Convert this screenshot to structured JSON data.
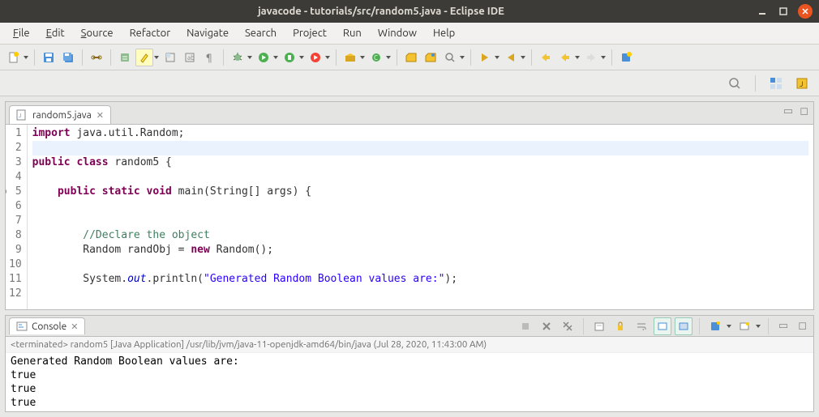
{
  "window": {
    "title": "javacode - tutorials/src/random5.java - Eclipse IDE"
  },
  "menu": {
    "file": "File",
    "edit": "Edit",
    "source": "Source",
    "refactor": "Refactor",
    "navigate": "Navigate",
    "search": "Search",
    "project": "Project",
    "run": "Run",
    "window": "Window",
    "help": "Help"
  },
  "editor": {
    "tab_name": "random5.java",
    "lines": [
      {
        "n": 1,
        "cls": "",
        "html": "<span class='kw'>import</span> java.util.Random;"
      },
      {
        "n": 2,
        "cls": "current",
        "html": ""
      },
      {
        "n": 3,
        "cls": "",
        "html": "<span class='kw'>public class</span> random5 {"
      },
      {
        "n": 4,
        "cls": "",
        "html": ""
      },
      {
        "n": 5,
        "cls": "",
        "html": "    <span class='kw'>public static void</span> main(String[] args) {"
      },
      {
        "n": 6,
        "cls": "",
        "html": ""
      },
      {
        "n": 7,
        "cls": "",
        "html": ""
      },
      {
        "n": 8,
        "cls": "",
        "html": "        <span class='comment'>//Declare the object</span>"
      },
      {
        "n": 9,
        "cls": "",
        "html": "        Random randObj = <span class='kw'>new</span> Random();"
      },
      {
        "n": 10,
        "cls": "",
        "html": ""
      },
      {
        "n": 11,
        "cls": "",
        "html": "        System.<span class='field'>out</span>.println(<span class='string'>\"Generated Random Boolean values are:\"</span>);"
      },
      {
        "n": 12,
        "cls": "",
        "html": ""
      }
    ]
  },
  "console": {
    "tab_name": "Console",
    "status_prefix": "<terminated>",
    "status_text": "random5 [Java Application] /usr/lib/jvm/java-11-openjdk-amd64/bin/java (Jul 28, 2020, 11:43:00 AM)",
    "output": [
      "Generated Random Boolean values are:",
      "true",
      "true",
      "true"
    ]
  }
}
